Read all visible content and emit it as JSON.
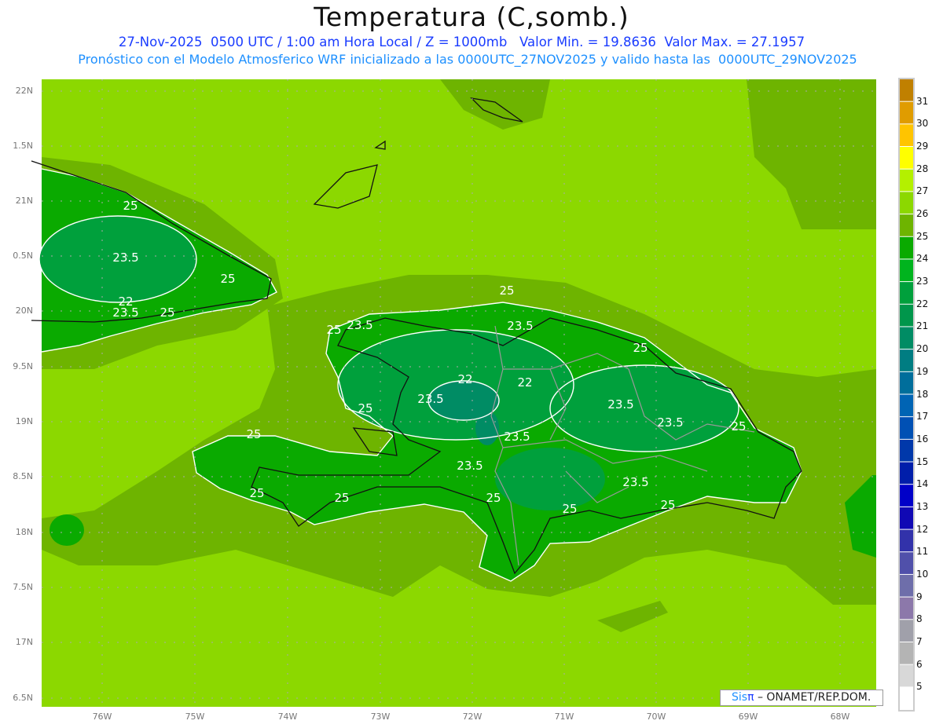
{
  "title": "Temperatura (C,somb.)",
  "subtitle_line1": "27-Nov-2025  0500 UTC / 1:00 am Hora Local / Z = 1000mb   Valor Min. = 19.8636  Valor Max. = 27.1957",
  "subtitle_line2": "Pronóstico con el Modelo Atmosferico WRF inicializado a las 0000UTC_27NOV2025 y valido hasta las  0000UTC_29NOV2025",
  "lat_labels": [
    "22N",
    "1.5N",
    "21N",
    "0.5N",
    "20N",
    "9.5N",
    "19N",
    "8.5N",
    "18N",
    "7.5N",
    "17N",
    "6.5N"
  ],
  "lon_labels": [
    "76W",
    "75W",
    "74W",
    "73W",
    "72W",
    "71W",
    "70W",
    "69W",
    "68W"
  ],
  "colorbar": {
    "labels": [
      "31",
      "30",
      "29",
      "28",
      "27",
      "26",
      "25",
      "24",
      "23",
      "22",
      "21",
      "20",
      "19",
      "18",
      "17",
      "16",
      "15",
      "14",
      "13",
      "12",
      "11",
      "10",
      "9",
      "8",
      "7",
      "6",
      "5"
    ],
    "colors": [
      "#c08000",
      "#e09c00",
      "#ffc400",
      "#ffff00",
      "#b4f000",
      "#8cd800",
      "#6eb400",
      "#0aaa00",
      "#00b41e",
      "#00a03c",
      "#00964b",
      "#008c64",
      "#007d82",
      "#006e9b",
      "#0064b4",
      "#0050b4",
      "#0038aa",
      "#001eaa",
      "#0000c8",
      "#1008b4",
      "#3232aa",
      "#5050aa",
      "#6e6eaa",
      "#8c78aa",
      "#a0a0aa",
      "#b4b4b4",
      "#d8d8d8",
      "#ffffff"
    ]
  },
  "contour_labels": [
    "25",
    "23.5",
    "25",
    "22",
    "23.5",
    "25",
    "25",
    "23.5",
    "25",
    "23.5",
    "25",
    "22",
    "22",
    "23.5",
    "25",
    "23.5",
    "23.5",
    "25",
    "25",
    "23.5",
    "23.5",
    "23.5",
    "25",
    "25",
    "25",
    "25",
    "25"
  ],
  "credit": {
    "brand": "Sis",
    "brand_symbol": "π",
    "text": " – ONAMET/REP.DOM."
  },
  "colors": {
    "sea": "#8cd800",
    "near_shore": "#6eb400",
    "land": "#0aaa00",
    "interior": "#00a03c",
    "cold": "#008c64"
  }
}
